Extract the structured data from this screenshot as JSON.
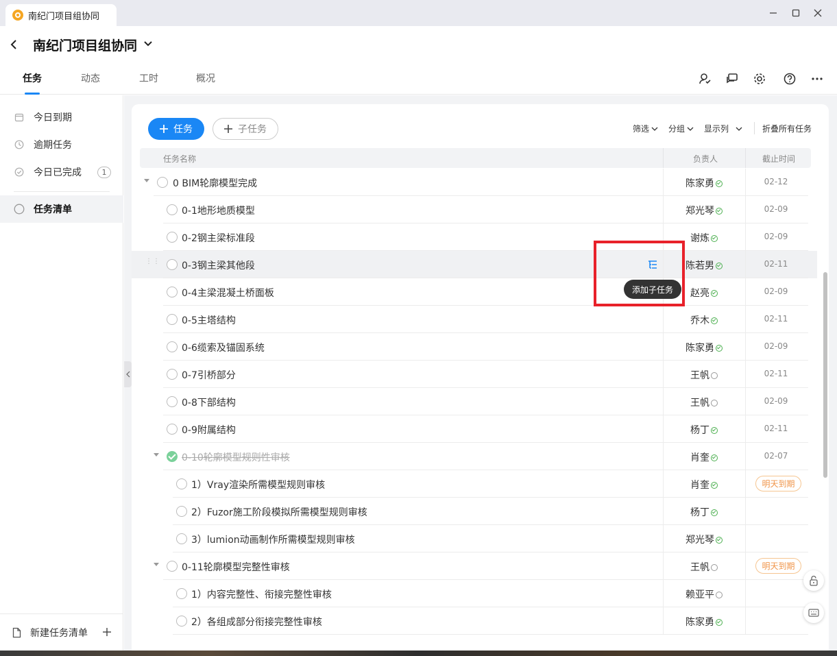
{
  "window": {
    "tab_title": "南纪门项目组协同"
  },
  "header": {
    "project_title": "南纪门项目组协同",
    "tabs": [
      "任务",
      "动态",
      "工时",
      "概况"
    ]
  },
  "sidebar": {
    "items": [
      {
        "label": "今日到期"
      },
      {
        "label": "逾期任务"
      },
      {
        "label": "今日已完成",
        "count": "1"
      },
      {
        "label": "任务清单"
      }
    ],
    "footer_label": "新建任务清单"
  },
  "toolbar": {
    "add_task": "任务",
    "add_subtask": "子任务",
    "filter": "筛选",
    "group": "分组",
    "columns": "显示列",
    "collapse_all": "折叠所有任务"
  },
  "table": {
    "columns": {
      "name": "任务名称",
      "owner": "负责人",
      "due": "截止时间"
    },
    "rows": [
      {
        "name": "0 BIM轮廓模型完成",
        "owner": "陈家勇",
        "due": "02-12"
      },
      {
        "name": "0-1地形地质模型",
        "owner": "郑光琴",
        "due": "02-09"
      },
      {
        "name": "0-2钢主梁标准段",
        "owner": "谢炼",
        "due": "02-09"
      },
      {
        "name": "0-3钢主梁其他段",
        "owner": "陈若男",
        "due": "02-11"
      },
      {
        "name": "0-4主梁混凝土桥面板",
        "owner": "赵亮",
        "due": "02-09"
      },
      {
        "name": "0-5主塔结构",
        "owner": "乔木",
        "due": "02-11"
      },
      {
        "name": "0-6缆索及锚固系统",
        "owner": "陈家勇",
        "due": "02-09"
      },
      {
        "name": "0-7引桥部分",
        "owner": "王帆",
        "due": "02-11"
      },
      {
        "name": "0-8下部结构",
        "owner": "王帆",
        "due": "02-09"
      },
      {
        "name": "0-9附属结构",
        "owner": "杨丁",
        "due": "02-11"
      },
      {
        "name": "0-10轮廓模型规则性审核",
        "owner": "肖奎",
        "due": "02-07"
      },
      {
        "name": "1）Vray渲染所需模型规则审核",
        "owner": "肖奎",
        "due": "明天到期"
      },
      {
        "name": "2）Fuzor施工阶段模拟所需模型规则审核",
        "owner": "杨丁",
        "due": ""
      },
      {
        "name": "3）lumion动画制作所需模型规则审核",
        "owner": "郑光琴",
        "due": ""
      },
      {
        "name": "0-11轮廓模型完整性审核",
        "owner": "王帆",
        "due": "明天到期"
      },
      {
        "name": "1）内容完整性、衔接完整性审核",
        "owner": "赖亚平",
        "due": ""
      },
      {
        "name": "2）各组成部分衔接完整性审核",
        "owner": "陈家勇",
        "due": ""
      }
    ]
  },
  "tooltip": "添加子任务",
  "colors": {
    "accent": "#1a87f5",
    "done": "#7bd19a",
    "warn": "#f0954a",
    "highlight": "#e8212a"
  }
}
